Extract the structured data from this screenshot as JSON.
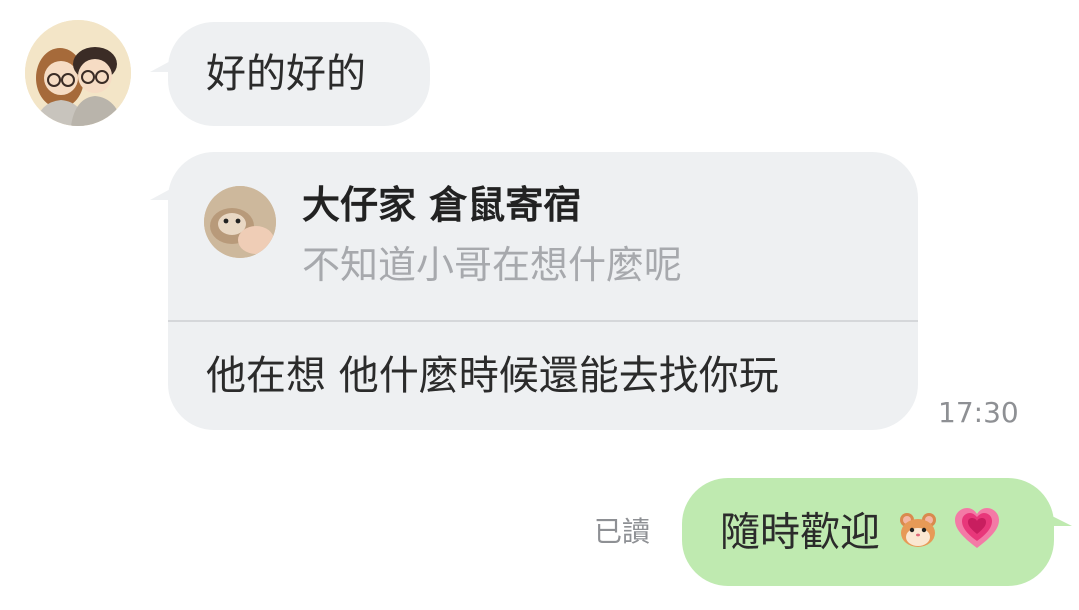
{
  "messages": {
    "incoming_1": {
      "text": "好的好的"
    },
    "incoming_reply": {
      "quote_author": "大仔家 倉鼠寄宿",
      "quote_text": "不知道小哥在想什麼呢",
      "reply_text": "他在想 他什麼時候還能去找你玩",
      "time": "17:30"
    },
    "outgoing_1": {
      "text": "隨時歡迎",
      "emojis": [
        "hamster-face",
        "growing-heart"
      ],
      "status": "已讀"
    }
  },
  "colors": {
    "incoming_bubble": "#eef0f2",
    "outgoing_bubble": "#bfeab0",
    "meta_text": "#8e9094",
    "quote_text": "#a7a9ad"
  }
}
